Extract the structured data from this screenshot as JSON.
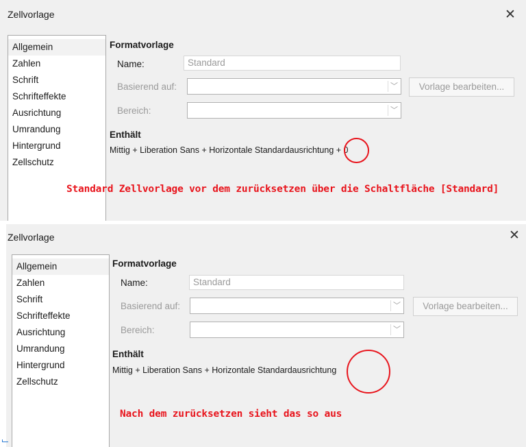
{
  "dialog1": {
    "title": "Zellvorlage",
    "close_glyph": "✕",
    "tabs": [
      "Allgemein",
      "Zahlen",
      "Schrift",
      "Schrifteffekte",
      "Ausrichtung",
      "Umrandung",
      "Hintergrund",
      "Zellschutz"
    ],
    "section_style": "Formatvorlage",
    "name_label": "Name:",
    "name_value": "Standard",
    "based_on_label": "Basierend auf:",
    "edit_button": "Vorlage bearbeiten...",
    "area_label": "Bereich:",
    "section_contains": "Enthält",
    "contains_text": "Mittig + Liberation Sans + Horizontale Standardausrichtung + 0",
    "annotation": "Standard Zellvorlage vor dem zurücksetzen über die Schaltfläche [Standard]"
  },
  "dialog2": {
    "title": "Zellvorlage",
    "close_glyph": "✕",
    "tabs": [
      "Allgemein",
      "Zahlen",
      "Schrift",
      "Schrifteffekte",
      "Ausrichtung",
      "Umrandung",
      "Hintergrund",
      "Zellschutz"
    ],
    "section_style": "Formatvorlage",
    "name_label": "Name:",
    "name_value": "Standard",
    "based_on_label": "Basierend auf:",
    "edit_button": "Vorlage bearbeiten...",
    "area_label": "Bereich:",
    "section_contains": "Enthält",
    "contains_text": "Mittig + Liberation Sans + Horizontale Standardausrichtung",
    "annotation": "Nach dem zurücksetzen sieht das so aus"
  },
  "icons": {
    "select_chevron": "chevron-down-icon",
    "close": "close-icon"
  },
  "colors": {
    "annotation": "#e8141c",
    "dialog_bg": "#f0f0f0",
    "disabled_text": "#9a9a9a"
  }
}
